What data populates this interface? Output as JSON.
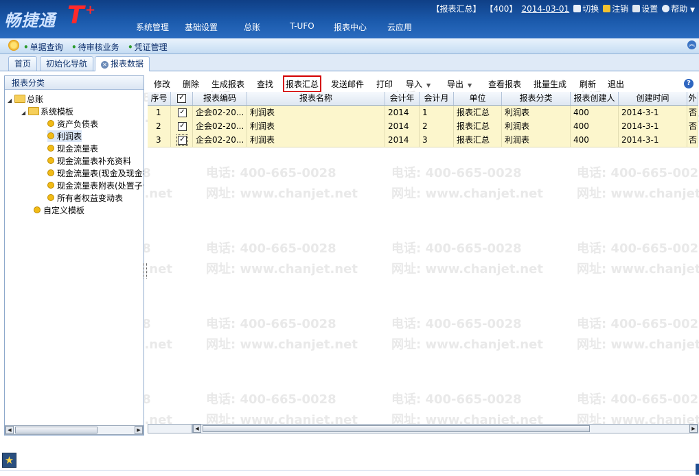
{
  "app": {
    "logo_text": "畅捷通",
    "logo_mark": "T",
    "logo_plus": "+",
    "main_nav": [
      "系统管理",
      "基础设置",
      "总账",
      "T-UFO",
      "报表中心",
      "云应用"
    ],
    "status": {
      "module": "【报表汇总】",
      "account": "【400】",
      "date": "2014-03-01",
      "switch": "切换",
      "logout": "注销",
      "settings": "设置",
      "help": "帮助"
    }
  },
  "quickbar": {
    "items": [
      "单据查询",
      "待审核业务",
      "凭证管理"
    ]
  },
  "tabs": [
    {
      "label": "首页"
    },
    {
      "label": "初始化导航"
    },
    {
      "label": "报表数据"
    }
  ],
  "left_panel": {
    "title": "报表分类",
    "root": "总账",
    "folder": "系统模板",
    "items": [
      "资产负债表",
      "利润表",
      "现金流量表",
      "现金流量表补充资料",
      "现金流量表(现金及现金等价物)",
      "现金流量表附表(处置子公司)",
      "所有者权益变动表"
    ],
    "custom": "自定义模板"
  },
  "toolbar": {
    "edit": "修改",
    "delete": "删除",
    "generate": "生成报表",
    "find": "查找",
    "summary": "报表汇总",
    "send_mail": "发送邮件",
    "print": "打印",
    "import": "导入",
    "export": "导出",
    "view": "查看报表",
    "batch": "批量生成",
    "refresh": "刷新",
    "exit": "退出"
  },
  "grid": {
    "columns": [
      "序号",
      "",
      "报表编码",
      "报表名称",
      "会计年",
      "会计月",
      "单位",
      "报表分类",
      "报表创建人",
      "创建时间",
      "外"
    ],
    "rows": [
      {
        "no": "1",
        "checked": "✓",
        "code": "企会02-20...",
        "name": "利润表",
        "year": "2014",
        "month": "1",
        "unit": "报表汇总",
        "category": "利润表",
        "creator": "400",
        "created": "2014-3-1",
        "ext": "否"
      },
      {
        "no": "2",
        "checked": "✓",
        "code": "企会02-20...",
        "name": "利润表",
        "year": "2014",
        "month": "2",
        "unit": "报表汇总",
        "category": "利润表",
        "creator": "400",
        "created": "2014-3-1",
        "ext": "否"
      },
      {
        "no": "3",
        "checked": "✓",
        "code": "企会02-20...",
        "name": "利润表",
        "year": "2014",
        "month": "3",
        "unit": "报表汇总",
        "category": "利润表",
        "creator": "400",
        "created": "2014-3-1",
        "ext": "否"
      }
    ]
  },
  "watermark": {
    "phone": "电话: 400-665-0028",
    "web": "网址: www.chanjet.net"
  },
  "colors": {
    "topbar": "#1b5aac",
    "row_highlight": "#fcf6cc",
    "summary_outline": "#d40000"
  }
}
